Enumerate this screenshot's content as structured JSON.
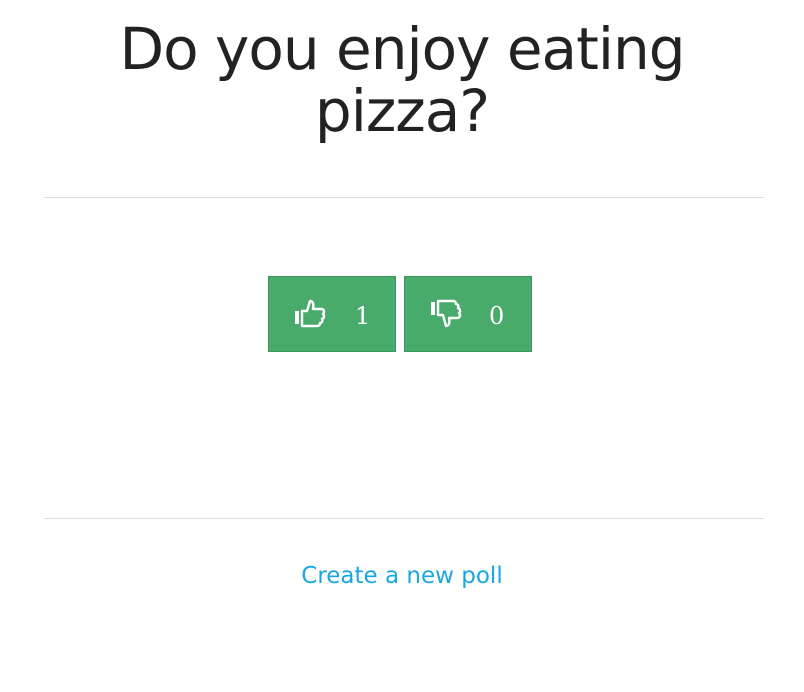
{
  "poll": {
    "question": "Do you enjoy eating pizza?",
    "upvote": {
      "icon": "thumbs-up-icon",
      "count": "1"
    },
    "downvote": {
      "icon": "thumbs-down-icon",
      "count": "0"
    }
  },
  "footer": {
    "new_poll_label": "Create a new poll"
  },
  "colors": {
    "button_bg": "#48aa6b",
    "link": "#1aa7e0",
    "divider": "#dddddd"
  }
}
